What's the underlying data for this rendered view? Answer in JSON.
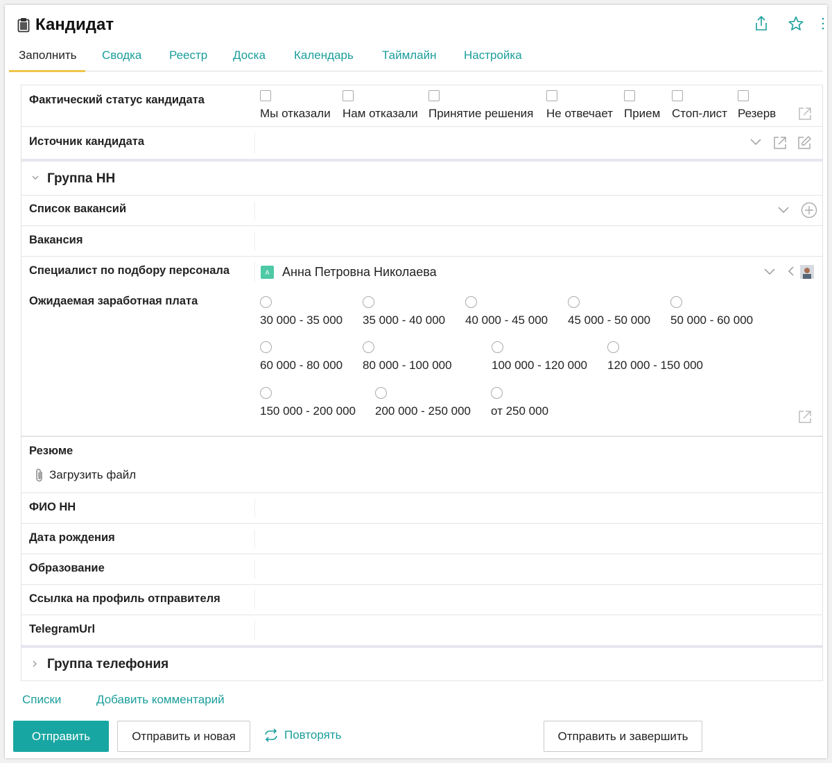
{
  "header": {
    "title": "Кандидат",
    "icons": [
      "clipboard-icon",
      "share-icon",
      "star-icon",
      "more-vertical-icon"
    ],
    "accent": "#1a9e9b"
  },
  "tabs": [
    {
      "label": "Заполнить",
      "active": true
    },
    {
      "label": "Сводка"
    },
    {
      "label": "Реестр"
    },
    {
      "label": "Доска"
    },
    {
      "label": "Календарь"
    },
    {
      "label": "Таймлайн"
    },
    {
      "label": "Настройка"
    }
  ],
  "fields": {
    "status": {
      "label": "Фактический статус кандидата",
      "options": [
        "Мы отказали",
        "Нам отказали",
        "Принятие решения",
        "Не отвечает",
        "Прием",
        "Стоп-лист",
        "Резерв"
      ]
    },
    "source": {
      "label": "Источник кандидата"
    },
    "group_hh": {
      "title": "Группа НН"
    },
    "vacancy_list": {
      "label": "Список вакансий"
    },
    "vacancy": {
      "label": "Вакансия"
    },
    "recruiter": {
      "label": "Специалист по подбору персонала",
      "value": "Анна Петровна Николаева",
      "badge": "A",
      "badge_color": "#4ec9a6"
    },
    "salary": {
      "label": "Ожидаемая заработная плата",
      "rows": [
        [
          "30 000 - 35 000",
          "35 000 - 40 000",
          "40 000 - 45 000",
          "45 000 - 50 000",
          "50 000 - 60 000"
        ],
        [
          "60 000 - 80 000",
          "80 000 - 100 000",
          "100 000 - 120 000",
          "120 000 - 150 000"
        ],
        [
          "150 000 - 200 000",
          "200 000 - 250 000",
          "от 250 000"
        ]
      ]
    },
    "resume": {
      "label": "Резюме",
      "upload": "Загрузить файл"
    },
    "fio": {
      "label": "ФИО НН"
    },
    "birth": {
      "label": "Дата рождения"
    },
    "education": {
      "label": "Образование"
    },
    "profile_link": {
      "label": "Ссылка на профиль отправителя"
    },
    "telegram": {
      "label": "TelegramUrl"
    },
    "group_phone": {
      "title": "Группа телефония"
    }
  },
  "footer": {
    "links": [
      "Списки",
      "Добавить комментарий"
    ],
    "submit": "Отправить",
    "submit_new": "Отправить и новая",
    "repeat": "Повторять",
    "submit_finish": "Отправить и завершить"
  }
}
